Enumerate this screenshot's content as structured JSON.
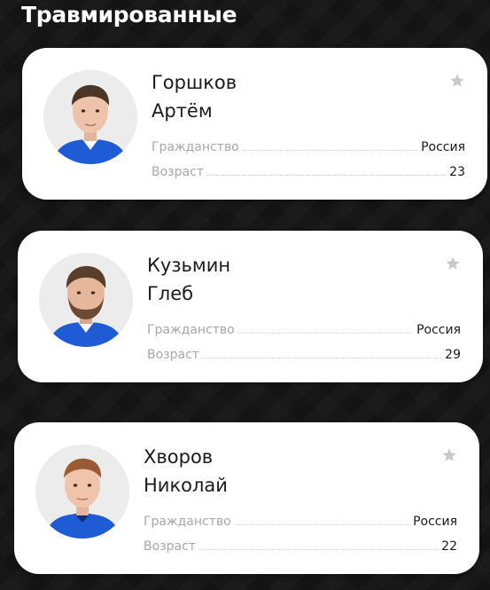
{
  "section": {
    "title": "Травмированные"
  },
  "labels": {
    "citizenship": "Гражданство",
    "age": "Возраст"
  },
  "players": [
    {
      "surname": "Горшков",
      "first_name": "Артём",
      "citizenship": "Россия",
      "age": "23"
    },
    {
      "surname": "Кузьмин",
      "first_name": "Глеб",
      "citizenship": "Россия",
      "age": "29"
    },
    {
      "surname": "Хворов",
      "first_name": "Николай",
      "citizenship": "Россия",
      "age": "22"
    }
  ],
  "colors": {
    "background": "#141414",
    "card": "#ffffff",
    "jersey": "#1f5bd4",
    "star": "#c8c8c8",
    "label": "#a7a7a7"
  },
  "icons": {
    "favorite": "star-icon"
  }
}
